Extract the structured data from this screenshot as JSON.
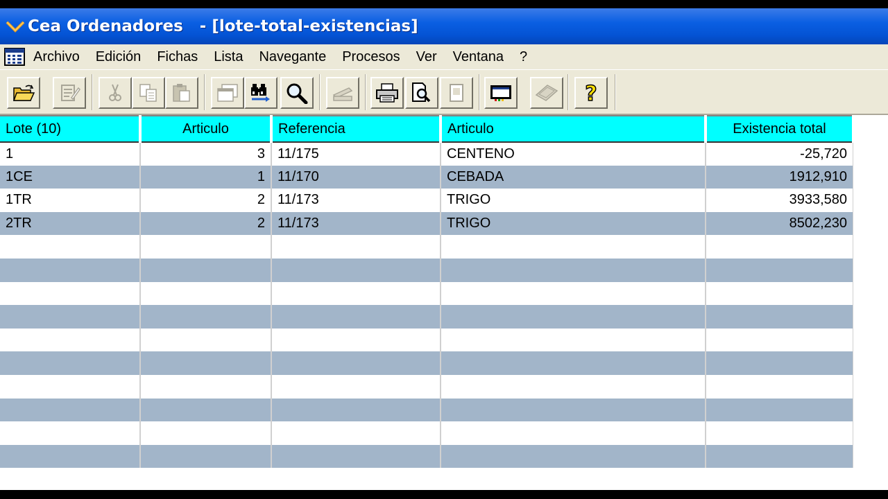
{
  "window": {
    "title": "Cea Ordenadores   - [lote-total-existencias]"
  },
  "menu": {
    "items": [
      "Archivo",
      "Edición",
      "Fichas",
      "Lista",
      "Navegante",
      "Procesos",
      "Ver",
      "Ventana",
      "?"
    ]
  },
  "toolbar": {
    "buttons": [
      {
        "icon": "open-folder-icon",
        "enabled": true
      },
      {
        "icon": "edit-record-icon",
        "enabled": false
      },
      {
        "icon": "cut-icon",
        "enabled": false
      },
      {
        "icon": "copy-icon",
        "enabled": false
      },
      {
        "icon": "paste-icon",
        "enabled": false
      },
      {
        "icon": "new-window-icon",
        "enabled": false
      },
      {
        "icon": "find-binoculars-icon",
        "enabled": true
      },
      {
        "icon": "zoom-search-icon",
        "enabled": true
      },
      {
        "icon": "scanner-icon",
        "enabled": false
      },
      {
        "icon": "print-icon",
        "enabled": true
      },
      {
        "icon": "print-preview-icon",
        "enabled": true
      },
      {
        "icon": "page-icon",
        "enabled": false
      },
      {
        "icon": "monitor-icon",
        "enabled": true
      },
      {
        "icon": "eraser-icon",
        "enabled": false
      },
      {
        "icon": "help-icon",
        "enabled": true
      }
    ]
  },
  "table": {
    "columns": [
      {
        "label": "Lote (10)",
        "align": "left"
      },
      {
        "label": "Articulo",
        "align": "center"
      },
      {
        "label": "Referencia",
        "align": "left"
      },
      {
        "label": "Articulo",
        "align": "left"
      },
      {
        "label": "Existencia total",
        "align": "center"
      }
    ],
    "rows": [
      [
        "1",
        "3",
        "11/175",
        "CENTENO",
        "-25,720"
      ],
      [
        "1CE",
        "1",
        "11/170",
        "CEBADA",
        "1912,910"
      ],
      [
        "1TR",
        "2",
        "11/173",
        "TRIGO",
        "3933,580"
      ],
      [
        "2TR",
        "2",
        "11/173",
        "TRIGO",
        "8502,230"
      ]
    ],
    "empty_rows": 10
  }
}
